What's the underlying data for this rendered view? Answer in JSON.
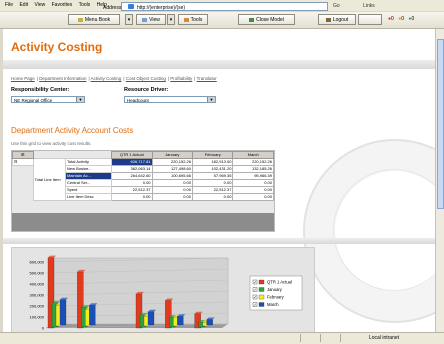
{
  "browser": {
    "menu": [
      "File",
      "Edit",
      "View",
      "Favorites",
      "Tools",
      "Help"
    ],
    "address_label": "Address",
    "address_value": "http://(enterprise)/(se)",
    "go": "Go",
    "links": "Links",
    "toolbar": {
      "menu_book": "Menu Book",
      "view": "View",
      "tools": "Tools",
      "close_model": "Close Model",
      "logout": "Logout"
    },
    "status_values": [
      "0",
      "0",
      "0"
    ],
    "status_zone": "Local intranet"
  },
  "page": {
    "title": "Activity Costing",
    "nav": [
      "Home Page",
      "Department Information",
      "Activity Costing",
      "Cost Object Costing",
      "Profitability",
      "Translator"
    ],
    "responsibility_label": "Responsibility Center:",
    "responsibility_value": "NE Regional Office",
    "driver_label": "Resource Driver:",
    "driver_value": "Headcount",
    "section_title": "Department Activity Account Costs",
    "hint": "Use this grid to view activity cost results.",
    "grid": {
      "headers": [
        "QTR 1 Actual",
        "January",
        "February",
        "March"
      ],
      "row_group": "Total Line Item",
      "rows": [
        {
          "label": "Total Activity",
          "values": [
            "626,717.81",
            "220,152.26",
            "182,913.00",
            "220,152.26"
          ]
        },
        {
          "label": "New Busine...",
          "values": [
            "362,063.14",
            "127,498.60",
            "102,431.20",
            "132,185.26"
          ]
        },
        {
          "label": "Maintain Ac...",
          "values": [
            "264,642.60",
            "100,695.66",
            "57,969.35",
            "95,966.39"
          ]
        },
        {
          "label": "Central Ser...",
          "values": [
            "0.00",
            "0.00",
            "0.00",
            "0.00"
          ]
        },
        {
          "label": "Spent",
          "values": [
            "22,512.37",
            "0.00",
            "22,512.37",
            "0.00"
          ]
        },
        {
          "label": "Line Item Desc",
          "values": [
            "0.00",
            "0.00",
            "0.00",
            "0.00"
          ]
        }
      ]
    },
    "chart_data": {
      "type": "bar",
      "categories": [
        "",
        "",
        "",
        "",
        "",
        ""
      ],
      "series": [
        {
          "name": "QTR 1 Actual",
          "values": [
            640000,
            510000,
            0,
            310000,
            250000,
            130000
          ]
        },
        {
          "name": "January",
          "values": [
            220000,
            180000,
            0,
            110000,
            90000,
            45000
          ]
        },
        {
          "name": "February",
          "values": [
            190000,
            150000,
            0,
            90000,
            80000,
            35000
          ]
        },
        {
          "name": "March",
          "values": [
            230000,
            180000,
            0,
            120000,
            80000,
            50000
          ]
        }
      ],
      "ylim": [
        0,
        600000
      ],
      "yticks": [
        "0",
        "100,000",
        "200,000",
        "300,000",
        "400,000",
        "500,000",
        "600,000"
      ],
      "colors": [
        "#e3391c",
        "#2fa33b",
        "#f5ec1f",
        "#1b4fb8"
      ],
      "legend": "right"
    }
  }
}
